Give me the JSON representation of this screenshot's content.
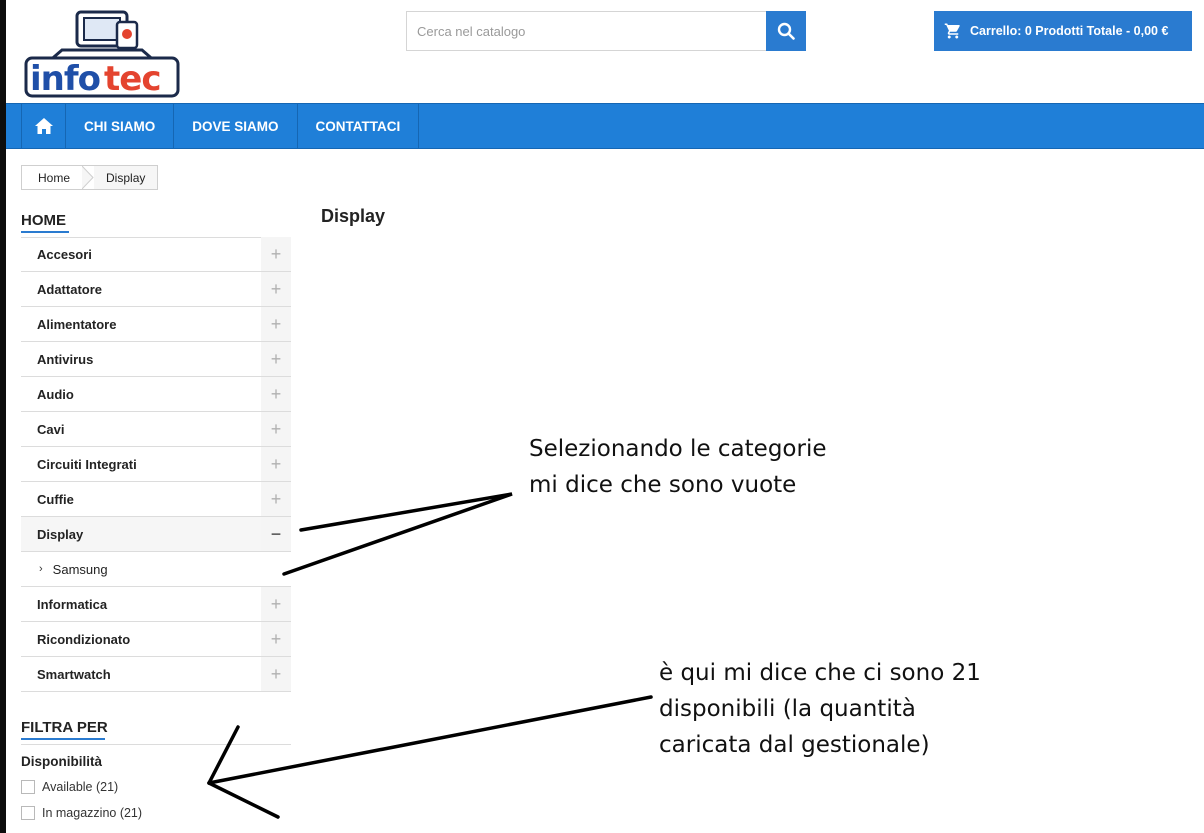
{
  "header": {
    "logo_text": "infotec",
    "search_placeholder": "Cerca nel catalogo",
    "cart_label": "Carrello: 0 Prodotti Totale - 0,00 €"
  },
  "nav": {
    "items": [
      "CHI SIAMO",
      "DOVE SIAMO",
      "CONTATTACI"
    ]
  },
  "breadcrumb": [
    "Home",
    "Display"
  ],
  "page_title": "Display",
  "sidebar": {
    "title": "HOME",
    "categories": [
      {
        "label": "Accesori",
        "toggle": "+"
      },
      {
        "label": "Adattatore",
        "toggle": "+"
      },
      {
        "label": "Alimentatore",
        "toggle": "+"
      },
      {
        "label": "Antivirus",
        "toggle": "+"
      },
      {
        "label": "Audio",
        "toggle": "+"
      },
      {
        "label": "Cavi",
        "toggle": "+"
      },
      {
        "label": "Circuiti Integrati",
        "toggle": "+"
      },
      {
        "label": "Cuffie",
        "toggle": "+"
      },
      {
        "label": "Display",
        "toggle": "−"
      },
      {
        "label": "Informatica",
        "toggle": "+"
      },
      {
        "label": "Ricondizionato",
        "toggle": "+"
      },
      {
        "label": "Smartwatch",
        "toggle": "+"
      }
    ],
    "subcategory": "Samsung"
  },
  "filters": {
    "title": "FILTRA PER",
    "facet_title": "Disponibilità",
    "options": [
      "Available (21)",
      "In magazzino (21)"
    ]
  },
  "annotations": {
    "note1": "Selezionando le categorie\nmi dice che sono vuote",
    "note2": "è qui mi dice che ci sono 21\ndisponibili (la quantità\ncaricata dal gestionale)"
  },
  "colors": {
    "accent": "#2a7bd0",
    "nav": "#1f7fd8",
    "logo_blue": "#1f4fa8",
    "logo_red": "#e4442f"
  }
}
